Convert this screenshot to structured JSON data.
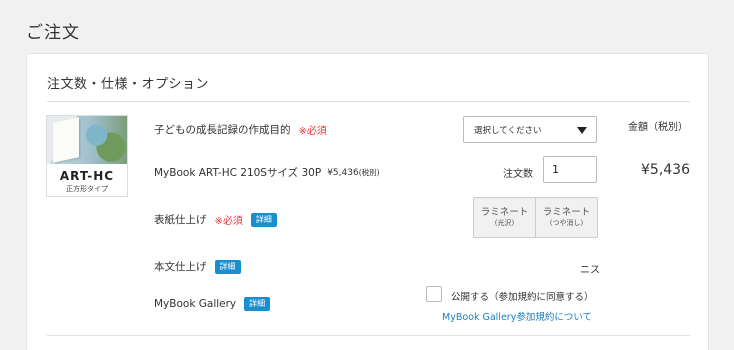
{
  "page": {
    "title": "ご注文"
  },
  "section": {
    "title": "注文数・仕様・オプション"
  },
  "product": {
    "thumb_name": "ART-HC",
    "thumb_sub": "正方形タイプ",
    "name_line": "MyBook ART-HC 210Sサイズ 30P",
    "unit_price": "¥5,436",
    "unit_tax_note": "(税別)"
  },
  "purpose": {
    "label": "子どもの成長記録の作成目的",
    "required": "※必須",
    "select_value": "選択してください"
  },
  "price": {
    "header": "金額（税別）",
    "total": "¥5,436"
  },
  "quantity": {
    "label": "注文数",
    "value": "1"
  },
  "cover_finish": {
    "label": "表紙仕上げ",
    "required": "※必須",
    "detail": "詳細",
    "options": [
      {
        "main": "ラミネート",
        "sub": "(光沢)"
      },
      {
        "main": "ラミネート",
        "sub": "(つや消し)"
      }
    ]
  },
  "body_finish": {
    "label": "本文仕上げ",
    "detail": "詳細",
    "value": "ニス"
  },
  "gallery": {
    "label": "MyBook Gallery",
    "detail": "詳細",
    "checkbox_label": "公開する（参加規約に同意する）",
    "link": "MyBook Gallery参加規約について"
  },
  "colors": {
    "accent": "#1a8fcf",
    "required": "#e8383d",
    "link": "#1a7fc1"
  }
}
